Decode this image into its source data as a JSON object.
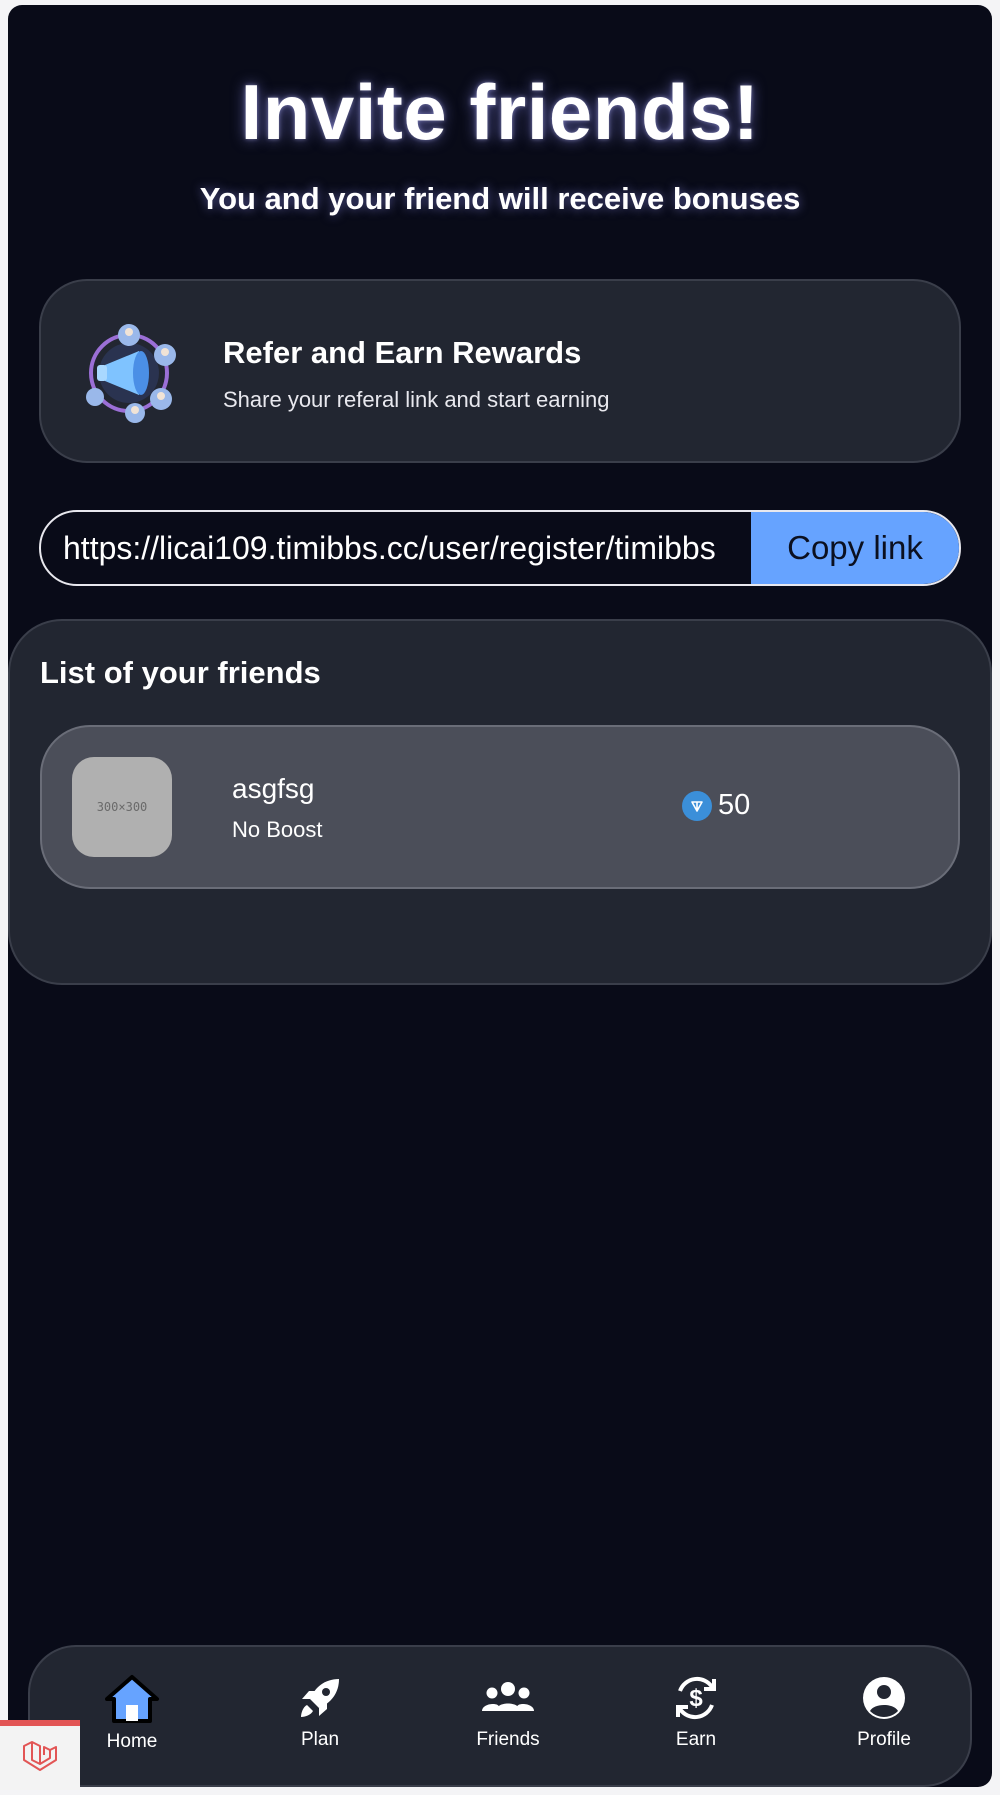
{
  "header": {
    "title": "Invite friends!",
    "subtitle": "You and your friend will receive bonuses"
  },
  "refer_card": {
    "icon": "megaphone-people-icon",
    "title": "Refer and Earn Rewards",
    "description": "Share your referal link and start earning"
  },
  "referral": {
    "link": "https://licai109.timibbs.cc/user/register/timibbs",
    "copy_label": "Copy link"
  },
  "friends": {
    "title": "List of your friends",
    "items": [
      {
        "avatar_text": "300×300",
        "name": "asgfsg",
        "boost": "No Boost",
        "reward_icon": "ton-coin-icon",
        "reward": "50"
      }
    ]
  },
  "nav": {
    "items": [
      {
        "label": "Home",
        "icon": "home-icon",
        "active": true
      },
      {
        "label": "Plan",
        "icon": "rocket-icon"
      },
      {
        "label": "Friends",
        "icon": "users-icon"
      },
      {
        "label": "Earn",
        "icon": "dollar-exchange-icon"
      },
      {
        "label": "Profile",
        "icon": "user-circle-icon"
      }
    ]
  },
  "colors": {
    "background": "#090b18",
    "card": "#222631",
    "friend_row": "#4b4e59",
    "accent": "#66a3ff",
    "ton": "#3b8fd9"
  }
}
